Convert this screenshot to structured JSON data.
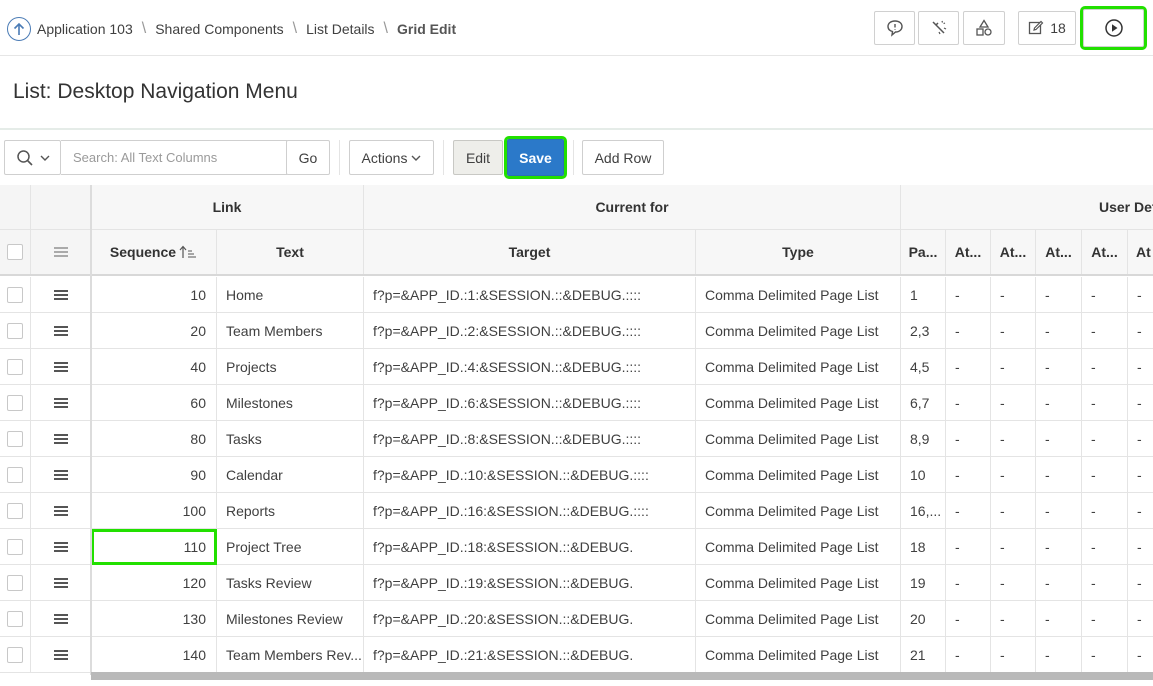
{
  "breadcrumb": {
    "items": [
      "Application 103",
      "Shared Components",
      "List Details"
    ],
    "current": "Grid Edit"
  },
  "toolbar_top": {
    "developer_comments_icon": "comment-icon",
    "teamdev_icon": "wand-icon",
    "shared_icon": "shapes-icon",
    "edit_count": "18",
    "run_icon": "play-icon"
  },
  "page": {
    "title": "List: Desktop Navigation Menu"
  },
  "grid_toolbar": {
    "search_placeholder": "Search: All Text Columns",
    "go_label": "Go",
    "actions_label": "Actions",
    "edit_label": "Edit",
    "save_label": "Save",
    "add_row_label": "Add Row"
  },
  "grid": {
    "groups": {
      "link": "Link",
      "current_for": "Current for",
      "user_def": "User Def"
    },
    "columns": {
      "sequence": "Sequence",
      "text": "Text",
      "target": "Target",
      "type": "Type",
      "pa": "Pa...",
      "at1": "At...",
      "at2": "At...",
      "at3": "At...",
      "at4": "At...",
      "at5": "At"
    },
    "rows": [
      {
        "seq": "10",
        "text": "Home",
        "target": "f?p=&APP_ID.:1:&SESSION.::&DEBUG.::::",
        "type": "Comma Delimited Page List",
        "pages": "1",
        "a1": "-",
        "a2": "-",
        "a3": "-",
        "a4": "-",
        "a5": "-"
      },
      {
        "seq": "20",
        "text": "Team Members",
        "target": "f?p=&APP_ID.:2:&SESSION.::&DEBUG.::::",
        "type": "Comma Delimited Page List",
        "pages": "2,3",
        "a1": "-",
        "a2": "-",
        "a3": "-",
        "a4": "-",
        "a5": "-"
      },
      {
        "seq": "40",
        "text": "Projects",
        "target": "f?p=&APP_ID.:4:&SESSION.::&DEBUG.::::",
        "type": "Comma Delimited Page List",
        "pages": "4,5",
        "a1": "-",
        "a2": "-",
        "a3": "-",
        "a4": "-",
        "a5": "-"
      },
      {
        "seq": "60",
        "text": "Milestones",
        "target": "f?p=&APP_ID.:6:&SESSION.::&DEBUG.::::",
        "type": "Comma Delimited Page List",
        "pages": "6,7",
        "a1": "-",
        "a2": "-",
        "a3": "-",
        "a4": "-",
        "a5": "-"
      },
      {
        "seq": "80",
        "text": "Tasks",
        "target": "f?p=&APP_ID.:8:&SESSION.::&DEBUG.::::",
        "type": "Comma Delimited Page List",
        "pages": "8,9",
        "a1": "-",
        "a2": "-",
        "a3": "-",
        "a4": "-",
        "a5": "-"
      },
      {
        "seq": "90",
        "text": "Calendar",
        "target": "f?p=&APP_ID.:10:&SESSION.::&DEBUG.::::",
        "type": "Comma Delimited Page List",
        "pages": "10",
        "a1": "-",
        "a2": "-",
        "a3": "-",
        "a4": "-",
        "a5": "-"
      },
      {
        "seq": "100",
        "text": "Reports",
        "target": "f?p=&APP_ID.:16:&SESSION.::&DEBUG.::::",
        "type": "Comma Delimited Page List",
        "pages": "16,...",
        "a1": "-",
        "a2": "-",
        "a3": "-",
        "a4": "-",
        "a5": "-"
      },
      {
        "seq": "110",
        "text": "Project Tree",
        "target": "f?p=&APP_ID.:18:&SESSION.::&DEBUG.",
        "type": "Comma Delimited Page List",
        "pages": "18",
        "a1": "-",
        "a2": "-",
        "a3": "-",
        "a4": "-",
        "a5": "-"
      },
      {
        "seq": "120",
        "text": "Tasks Review",
        "target": "f?p=&APP_ID.:19:&SESSION.::&DEBUG.",
        "type": "Comma Delimited Page List",
        "pages": "19",
        "a1": "-",
        "a2": "-",
        "a3": "-",
        "a4": "-",
        "a5": "-"
      },
      {
        "seq": "130",
        "text": "Milestones Review",
        "target": "f?p=&APP_ID.:20:&SESSION.::&DEBUG.",
        "type": "Comma Delimited Page List",
        "pages": "20",
        "a1": "-",
        "a2": "-",
        "a3": "-",
        "a4": "-",
        "a5": "-"
      },
      {
        "seq": "140",
        "text": "Team Members Rev...",
        "target": "f?p=&APP_ID.:21:&SESSION.::&DEBUG.",
        "type": "Comma Delimited Page List",
        "pages": "21",
        "a1": "-",
        "a2": "-",
        "a3": "-",
        "a4": "-",
        "a5": "-"
      }
    ]
  },
  "colors": {
    "accent_highlight": "#22e000",
    "save_button": "#2b79c9",
    "up_icon": "#4a7bb5"
  }
}
